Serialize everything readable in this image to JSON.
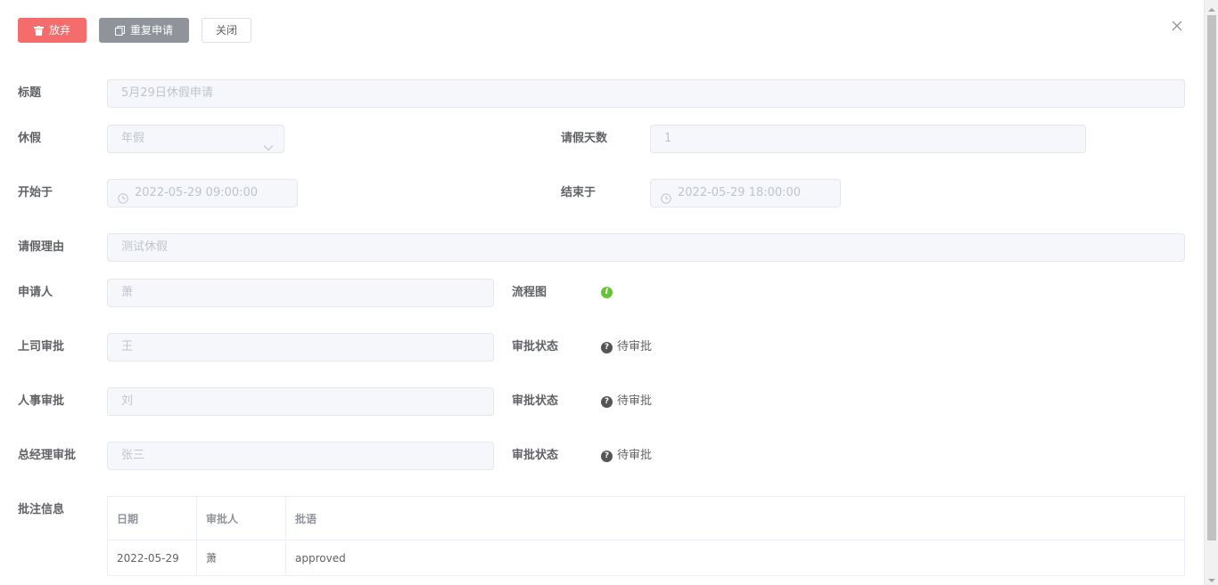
{
  "toolbar": {
    "abandon_label": "放弃",
    "reapply_label": "重复申请",
    "close_label": "关闭",
    "colors": {
      "danger": "#f56c6c",
      "info": "#909399"
    }
  },
  "form": {
    "title_label": "标题",
    "title_value": "5月29日休假申请",
    "leave_type_label": "休假",
    "leave_type_value": "年假",
    "days_label": "请假天数",
    "days_value": "1",
    "start_label": "开始于",
    "start_value": "2022-05-29 09:00:00",
    "end_label": "结束于",
    "end_value": "2022-05-29 18:00:00",
    "reason_label": "请假理由",
    "reason_value": "测试休假",
    "applicant_label": "申请人",
    "applicant_value": "萧",
    "flowchart_label": "流程图",
    "supervisor_label": "上司审批",
    "supervisor_value": "王",
    "supervisor_status_label": "审批状态",
    "supervisor_status_value": "待审批",
    "hr_label": "人事审批",
    "hr_value": "刘",
    "hr_status_label": "审批状态",
    "hr_status_value": "待审批",
    "gm_label": "总经理审批",
    "gm_value": "张三",
    "gm_status_label": "审批状态",
    "gm_status_value": "待审批",
    "comments_label": "批注信息"
  },
  "comments_table": {
    "headers": [
      "日期",
      "审批人",
      "批语"
    ],
    "rows": [
      [
        "2022-05-29",
        "萧",
        "approved"
      ]
    ]
  },
  "icons": {
    "abandon": "trash-icon",
    "reapply": "copy-icon",
    "close": "close-icon",
    "time": "clock-icon",
    "select": "chevron-down-icon",
    "flowchart": "info-icon",
    "status": "question-icon"
  }
}
